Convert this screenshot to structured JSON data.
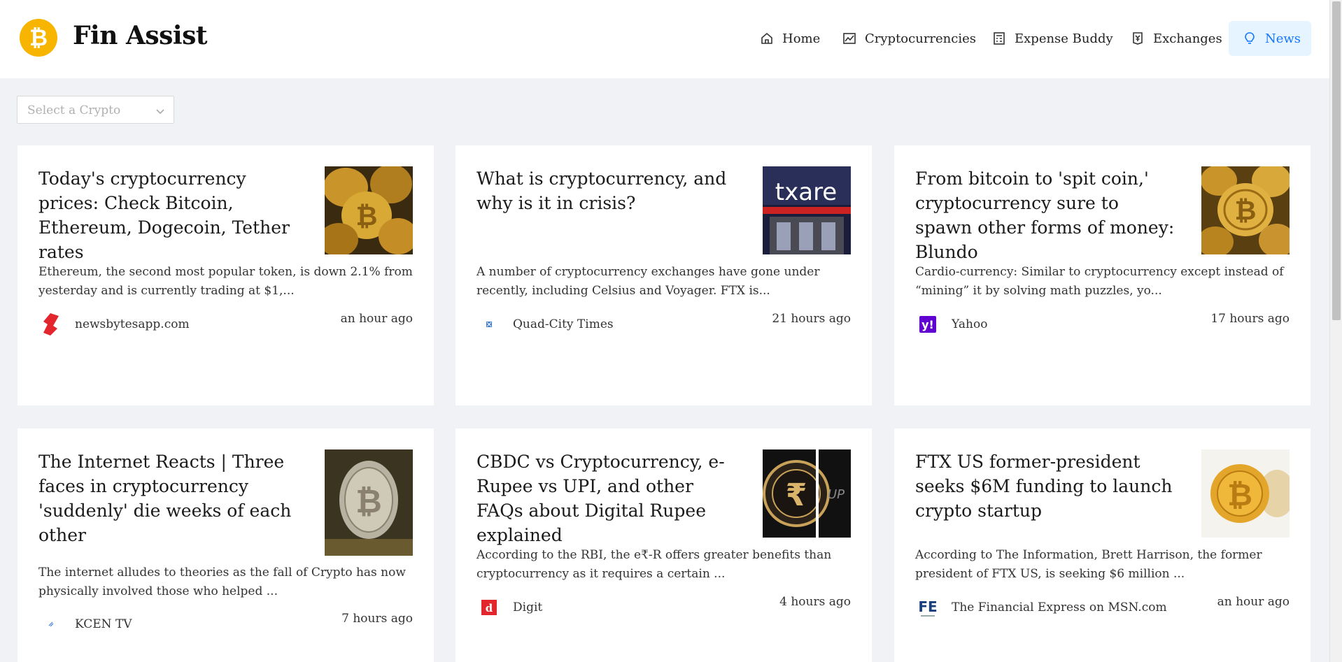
{
  "app": {
    "title": "Fin Assist",
    "logo_icon": "bitcoin-logo-icon"
  },
  "nav": [
    {
      "label": "Home",
      "icon": "home-icon"
    },
    {
      "label": "Cryptocurrencies",
      "icon": "line-chart-icon"
    },
    {
      "label": "Expense Buddy",
      "icon": "calculator-icon"
    },
    {
      "label": "Exchanges",
      "icon": "money-collect-icon"
    },
    {
      "label": "News",
      "icon": "bulb-icon",
      "active": true
    }
  ],
  "filter": {
    "placeholder": "Select a Crypto"
  },
  "articles": [
    {
      "title": "Today's cryptocurrency prices: Check Bitcoin, Ethereum, Dogecoin, Tether rates",
      "description": "Ethereum, the second most popular token, is down 2.1% from yesterday and is currently trading at $1,...",
      "source": "newsbytesapp.com",
      "time": "an hour ago",
      "thumb": "gold-coins-image"
    },
    {
      "title": "What is cryptocurrency, and why is it in crisis?",
      "description": "A number of cryptocurrency exchanges have gone under recently, including Celsius and Voyager. FTX is...",
      "source": "Quad-City Times",
      "time": "21 hours ago",
      "thumb": "ftx-arena-image"
    },
    {
      "title": "From bitcoin to 'spit coin,' cryptocurrency sure to spawn other forms of money: Blundo",
      "description": "Cardio-currency: Similar to cryptocurrency except instead of “mining” it by solving math puzzles, yo...",
      "source": "Yahoo",
      "time": "17 hours ago",
      "thumb": "bitcoin-pile-image"
    },
    {
      "title": "The Internet Reacts | Three faces in cryptocurrency 'suddenly' die weeks of each other",
      "description": "The internet alludes to theories as the fall of Crypto has now physically involved those who helped ...",
      "source": "KCEN TV",
      "time": "7 hours ago",
      "thumb": "silver-bitcoin-image"
    },
    {
      "title": "CBDC vs Cryptocurrency, e-Rupee vs UPI, and other FAQs about Digital Rupee explained",
      "description": "According to the RBI, the e₹-R offers greater benefits than cryptocurrency as it requires a certain ...",
      "source": "Digit",
      "time": "4 hours ago",
      "thumb": "rupee-coin-image"
    },
    {
      "title": "FTX US former-president seeks $6M funding to launch crypto startup",
      "description": "According to The Information, Brett Harrison, the former president of FTX US, is seeking $6 million ...",
      "source": "The Financial Express on MSN.com",
      "time": "an hour ago",
      "thumb": "gold-bitcoin-image"
    }
  ],
  "colors": {
    "accent": "#1677ff",
    "active_bg": "#e6f4ff",
    "logo": "#f7b500",
    "page_bg": "#f0f2f5"
  }
}
